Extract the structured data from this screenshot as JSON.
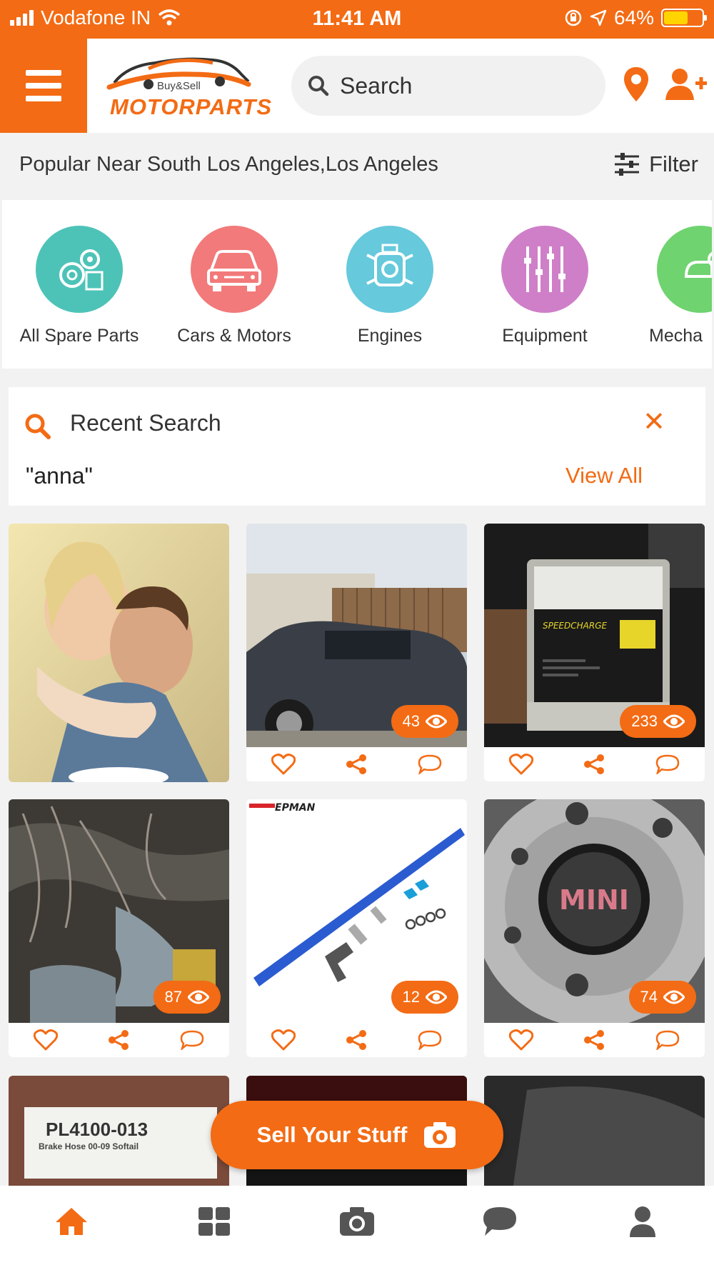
{
  "status_bar": {
    "carrier": "Vodafone IN",
    "time": "11:41 AM",
    "battery": "64%",
    "battery_level": 0.64
  },
  "header": {
    "logo_small": "Buy&Sell",
    "logo_big": "MOTORPARTS",
    "search_placeholder": "Search",
    "icons": [
      "menu-icon",
      "location-pin-icon",
      "add-user-icon",
      "search-icon"
    ]
  },
  "popular": {
    "text": "Popular Near South Los Angeles,Los Angeles",
    "filter_label": "Filter"
  },
  "categories": [
    {
      "label": "All Spare Parts",
      "color": "#4dc3b8",
      "icon": "gears-icon"
    },
    {
      "label": "Cars & Motors",
      "color": "#f27a7a",
      "icon": "car-icon"
    },
    {
      "label": "Engines",
      "color": "#66c9dc",
      "icon": "engine-icon"
    },
    {
      "label": "Equipment",
      "color": "#cf7fc8",
      "icon": "tools-icon"
    },
    {
      "label": "Mecha",
      "color": "#6fd36f",
      "icon": "mechanic-icon"
    }
  ],
  "recent_search": {
    "title": "Recent Search",
    "term": "\"anna\"",
    "view_all": "View All"
  },
  "listings": [
    {
      "views": null,
      "theme": "couple-ad"
    },
    {
      "views": "43",
      "theme": "suv"
    },
    {
      "views": "233",
      "theme": "charger"
    },
    {
      "views": "87",
      "theme": "engine-bay"
    },
    {
      "views": "12",
      "theme": "fuel-rail"
    },
    {
      "views": "74",
      "theme": "wheel"
    }
  ],
  "partial_listings": {
    "first_label": "PL4100-013",
    "first_sub": "Brake Hose 00-09 Softail"
  },
  "sell_button": {
    "label": "Sell Your Stuff"
  },
  "bottom_nav": [
    "home-icon",
    "grid-icon",
    "camera-icon",
    "chat-icon",
    "profile-icon"
  ],
  "colors": {
    "accent": "#f36b14",
    "background": "#f2f2f2"
  }
}
